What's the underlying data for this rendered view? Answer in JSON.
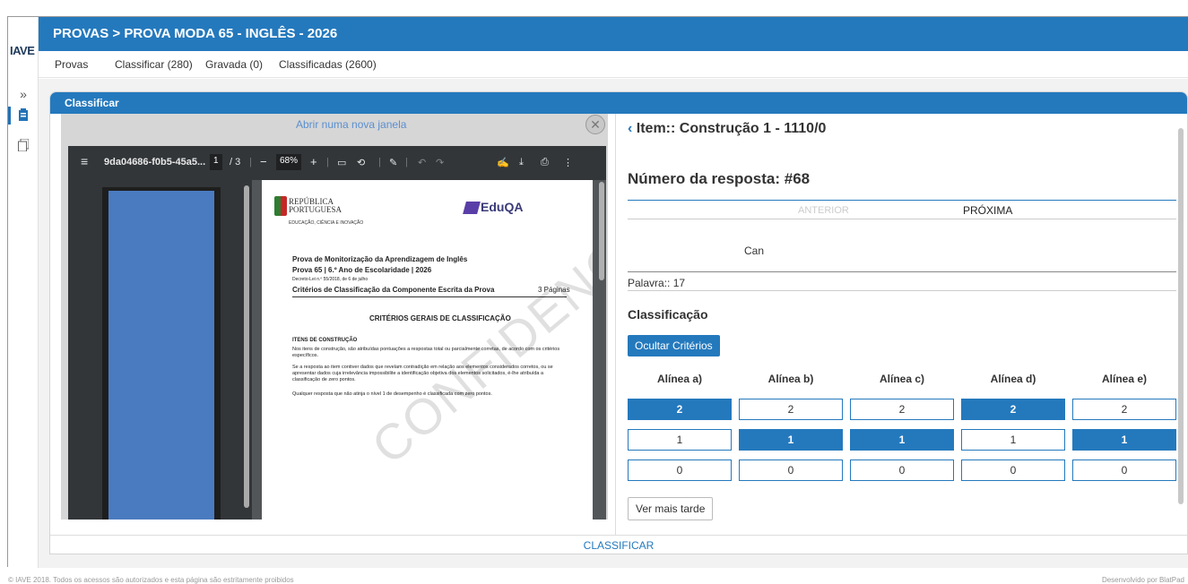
{
  "app": {
    "logo": "IAVE",
    "title": "PROVAS > PROVA MODA 65 - INGLÊS - 2026"
  },
  "tabs": [
    "Provas",
    "Classificar (280)",
    "Gravada (0)",
    "Classificadas (2600)"
  ],
  "sidebar_icons": [
    "double-chevron-right-icon",
    "clipboard-icon",
    "documents-icon"
  ],
  "card": {
    "title": "Classificar"
  },
  "viewer": {
    "open_link": "Abrir numa nova janela",
    "close_glyph": "✕",
    "filename": "9da04686-f0b5-45a5...",
    "page_current": "1",
    "page_sep": "/ 3",
    "zoom": "68%",
    "doc": {
      "rep_line1": "REPÚBLICA",
      "rep_line2": "PORTUGUESA",
      "rep_sub": "EDUCAÇÃO, CIÊNCIA E INOVAÇÃO",
      "eduqa": "EduQA",
      "title1": "Prova de Monitorização da Aprendizagem de Inglês",
      "title2": "Prova 65 | 6.º Ano de Escolaridade | 2026",
      "decree": "Decreto-Lei n.º 55/2018, de 6 de julho",
      "criteria": "Critérios de Classificação da Componente Escrita da Prova",
      "pages": "3 Páginas",
      "section": "CRITÉRIOS GERAIS DE CLASSIFICAÇÃO",
      "sub": "ITENS DE CONSTRUÇÃO",
      "p1": "Nos itens de construção, são atribuídas pontuações a respostas total ou parcialmente corretas, de acordo com os critérios específicos.",
      "p2": "Se a resposta ao item contiver dados que revelam contradição em relação aos elementos considerados corretos, ou se apresentar dados cuja irrelevância impossibilite a identificação objetiva dos elementos solicitados, é-lhe atribuída a classificação de zero pontos.",
      "p3": "Qualquer resposta que não atinja o nível 1 de desempenho é classificada com zero pontos.",
      "watermark": "CONFIDENCIAL"
    }
  },
  "grading": {
    "item_title": "Item:: Construção 1 - 1110/0",
    "response_number": "Número da resposta: #68",
    "prev_label": "ANTERIOR",
    "next_label": "PRÓXIMA",
    "answer_text": "Can",
    "word_count": "Palavra:: 17",
    "classification_label": "Classificação",
    "hide_criteria": "Ocultar Critérios",
    "alineas": [
      {
        "label": "Alínea a)",
        "selected": "2"
      },
      {
        "label": "Alínea b)",
        "selected": "1"
      },
      {
        "label": "Alínea c)",
        "selected": "1"
      },
      {
        "label": "Alínea d)",
        "selected": "2"
      },
      {
        "label": "Alínea e)",
        "selected": "1"
      }
    ],
    "score_rows": [
      "2",
      "1",
      "0"
    ],
    "later_button": "Ver mais tarde",
    "submit": "CLASSIFICAR"
  },
  "footer": {
    "left": "© IAVE 2018. Todos os acessos são autorizados e esta página são estritamente proibidos",
    "right": "Desenvolvido por BlatPad"
  },
  "colors": {
    "primary": "#2479bd"
  }
}
